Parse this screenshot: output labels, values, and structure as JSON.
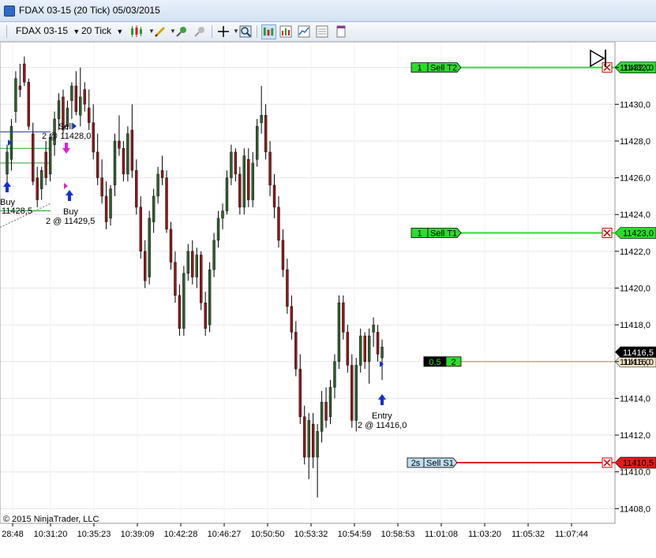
{
  "window": {
    "title": "FDAX 03-15 (20 Tick)  05/03/2015"
  },
  "toolbar": {
    "instrument": "FDAX 03-15",
    "interval": "20 Tick",
    "icons": [
      "candlestick-icon",
      "pencil-icon",
      "crosshair-icon",
      "magnifier-icon",
      "chart-trader-icon",
      "chart-type-icon",
      "properties-icon",
      "data-box-icon"
    ]
  },
  "price_axis": {
    "ticks": [
      "11432,0",
      "11430,0",
      "11428,0",
      "11426,0",
      "11424,0",
      "11422,0",
      "11420,0",
      "11418,0",
      "11416,0",
      "11414,0",
      "11412,0",
      "11410,0",
      "11408,0"
    ],
    "current_price": "11416,5",
    "last_price": "11416,0"
  },
  "time_axis": {
    "ticks": [
      "28:48",
      "10:31:20",
      "10:35:23",
      "10:39:09",
      "10:42:28",
      "10:46:27",
      "10:50:50",
      "10:53:32",
      "10:54:59",
      "10:58:53",
      "11:01:08",
      "11:03:20",
      "11:05:32",
      "11:07:44"
    ]
  },
  "orders": [
    {
      "qty": "1",
      "label": "Sell T2",
      "price": "11432,0",
      "kind": "target"
    },
    {
      "qty": "1",
      "label": "Sell T1",
      "price": "11423,0",
      "kind": "target"
    },
    {
      "qty": "2s",
      "label": "Sell S1",
      "price": "11410,5",
      "kind": "stop"
    }
  ],
  "position": {
    "pnl": "0,5",
    "qty": "2"
  },
  "executions": [
    {
      "title": "Buy",
      "detail": "11428,5"
    },
    {
      "title": "Sell",
      "detail": "2 @ 11428,0"
    },
    {
      "title": "Buy",
      "detail": "2 @ 11429,5"
    },
    {
      "title": "Entry",
      "detail": "2 @ 11416,0"
    }
  ],
  "copyright": "© 2015 NinjaTrader, LLC",
  "colors": {
    "up": "#2e5e2e",
    "down": "#8b1a1a",
    "target": "#2bdc2b",
    "stop": "#e01b1b",
    "position": "#c8a888"
  },
  "chart_data": {
    "type": "candlestick",
    "ylim": [
      11407.2,
      11433.4
    ],
    "candles": [
      {
        "o": 11426.2,
        "h": 11427.8,
        "l": 11425.4,
        "c": 11427.4
      },
      {
        "o": 11427.0,
        "h": 11429.2,
        "l": 11426.4,
        "c": 11428.8
      },
      {
        "o": 11429.6,
        "h": 11431.8,
        "l": 11429.0,
        "c": 11431.4
      },
      {
        "o": 11431.0,
        "h": 11432.2,
        "l": 11430.4,
        "c": 11430.8
      },
      {
        "o": 11432.2,
        "h": 11432.6,
        "l": 11431.0,
        "c": 11431.2
      },
      {
        "o": 11431.2,
        "h": 11431.4,
        "l": 11428.6,
        "c": 11428.8
      },
      {
        "o": 11428.4,
        "h": 11429.0,
        "l": 11425.6,
        "c": 11425.8
      },
      {
        "o": 11426.0,
        "h": 11426.6,
        "l": 11424.4,
        "c": 11424.8
      },
      {
        "o": 11425.4,
        "h": 11426.6,
        "l": 11424.8,
        "c": 11426.4
      },
      {
        "o": 11427.4,
        "h": 11428.0,
        "l": 11425.6,
        "c": 11426.0
      },
      {
        "o": 11426.2,
        "h": 11428.4,
        "l": 11425.8,
        "c": 11428.2
      },
      {
        "o": 11427.8,
        "h": 11429.6,
        "l": 11427.2,
        "c": 11429.2
      },
      {
        "o": 11429.2,
        "h": 11430.6,
        "l": 11428.6,
        "c": 11430.2
      },
      {
        "o": 11430.4,
        "h": 11430.8,
        "l": 11428.4,
        "c": 11428.6
      },
      {
        "o": 11428.8,
        "h": 11430.2,
        "l": 11428.6,
        "c": 11429.8
      },
      {
        "o": 11430.2,
        "h": 11431.2,
        "l": 11429.2,
        "c": 11431.0
      },
      {
        "o": 11431.0,
        "h": 11431.8,
        "l": 11429.4,
        "c": 11429.6
      },
      {
        "o": 11429.4,
        "h": 11432.0,
        "l": 11428.8,
        "c": 11430.4
      },
      {
        "o": 11430.8,
        "h": 11431.2,
        "l": 11429.6,
        "c": 11430.0
      },
      {
        "o": 11429.8,
        "h": 11430.8,
        "l": 11428.6,
        "c": 11429.0
      },
      {
        "o": 11429.0,
        "h": 11430.0,
        "l": 11427.0,
        "c": 11427.4
      },
      {
        "o": 11427.4,
        "h": 11428.4,
        "l": 11425.6,
        "c": 11426.0
      },
      {
        "o": 11426.0,
        "h": 11427.0,
        "l": 11424.6,
        "c": 11425.0
      },
      {
        "o": 11425.0,
        "h": 11425.8,
        "l": 11423.2,
        "c": 11423.6
      },
      {
        "o": 11423.8,
        "h": 11425.6,
        "l": 11423.4,
        "c": 11425.4
      },
      {
        "o": 11425.6,
        "h": 11428.4,
        "l": 11425.0,
        "c": 11428.0
      },
      {
        "o": 11428.0,
        "h": 11429.4,
        "l": 11427.2,
        "c": 11427.6
      },
      {
        "o": 11427.6,
        "h": 11428.0,
        "l": 11425.8,
        "c": 11426.2
      },
      {
        "o": 11426.2,
        "h": 11428.8,
        "l": 11425.8,
        "c": 11428.4
      },
      {
        "o": 11428.6,
        "h": 11430.0,
        "l": 11426.0,
        "c": 11426.4
      },
      {
        "o": 11426.4,
        "h": 11427.0,
        "l": 11424.0,
        "c": 11424.4
      },
      {
        "o": 11424.4,
        "h": 11425.0,
        "l": 11421.6,
        "c": 11422.0
      },
      {
        "o": 11422.0,
        "h": 11422.6,
        "l": 11420.0,
        "c": 11420.4
      },
      {
        "o": 11420.6,
        "h": 11424.2,
        "l": 11420.2,
        "c": 11423.8
      },
      {
        "o": 11423.6,
        "h": 11425.4,
        "l": 11423.0,
        "c": 11425.0
      },
      {
        "o": 11425.0,
        "h": 11426.6,
        "l": 11424.6,
        "c": 11426.2
      },
      {
        "o": 11426.4,
        "h": 11427.2,
        "l": 11425.6,
        "c": 11426.0
      },
      {
        "o": 11426.0,
        "h": 11426.4,
        "l": 11423.0,
        "c": 11423.2
      },
      {
        "o": 11423.2,
        "h": 11423.6,
        "l": 11421.0,
        "c": 11421.4
      },
      {
        "o": 11421.4,
        "h": 11422.0,
        "l": 11419.2,
        "c": 11419.6
      },
      {
        "o": 11419.6,
        "h": 11420.2,
        "l": 11417.4,
        "c": 11417.8
      },
      {
        "o": 11417.8,
        "h": 11421.2,
        "l": 11417.4,
        "c": 11420.8
      },
      {
        "o": 11420.8,
        "h": 11422.4,
        "l": 11420.4,
        "c": 11422.0
      },
      {
        "o": 11422.0,
        "h": 11422.6,
        "l": 11420.2,
        "c": 11420.6
      },
      {
        "o": 11420.6,
        "h": 11422.2,
        "l": 11420.0,
        "c": 11421.8
      },
      {
        "o": 11421.8,
        "h": 11422.0,
        "l": 11418.8,
        "c": 11419.2
      },
      {
        "o": 11419.2,
        "h": 11419.8,
        "l": 11417.4,
        "c": 11417.8
      },
      {
        "o": 11418.0,
        "h": 11421.4,
        "l": 11417.6,
        "c": 11421.0
      },
      {
        "o": 11421.0,
        "h": 11423.0,
        "l": 11420.6,
        "c": 11422.6
      },
      {
        "o": 11422.6,
        "h": 11424.2,
        "l": 11422.2,
        "c": 11423.8
      },
      {
        "o": 11423.8,
        "h": 11424.6,
        "l": 11423.2,
        "c": 11424.2
      },
      {
        "o": 11424.2,
        "h": 11426.4,
        "l": 11424.0,
        "c": 11426.0
      },
      {
        "o": 11426.0,
        "h": 11427.8,
        "l": 11425.6,
        "c": 11427.4
      },
      {
        "o": 11427.4,
        "h": 11427.6,
        "l": 11425.8,
        "c": 11426.2
      },
      {
        "o": 11426.2,
        "h": 11426.6,
        "l": 11424.0,
        "c": 11424.4
      },
      {
        "o": 11424.4,
        "h": 11427.6,
        "l": 11424.0,
        "c": 11427.2
      },
      {
        "o": 11427.0,
        "h": 11427.6,
        "l": 11424.4,
        "c": 11424.8
      },
      {
        "o": 11424.8,
        "h": 11427.4,
        "l": 11424.4,
        "c": 11426.8
      },
      {
        "o": 11427.0,
        "h": 11429.2,
        "l": 11426.6,
        "c": 11428.8
      },
      {
        "o": 11429.0,
        "h": 11431.0,
        "l": 11428.4,
        "c": 11429.4
      },
      {
        "o": 11429.4,
        "h": 11430.0,
        "l": 11427.0,
        "c": 11427.4
      },
      {
        "o": 11427.4,
        "h": 11428.0,
        "l": 11425.0,
        "c": 11425.6
      },
      {
        "o": 11425.6,
        "h": 11426.2,
        "l": 11423.8,
        "c": 11424.4
      },
      {
        "o": 11424.4,
        "h": 11425.0,
        "l": 11422.2,
        "c": 11422.6
      },
      {
        "o": 11422.6,
        "h": 11423.2,
        "l": 11420.6,
        "c": 11421.0
      },
      {
        "o": 11421.0,
        "h": 11421.6,
        "l": 11418.6,
        "c": 11419.0
      },
      {
        "o": 11419.0,
        "h": 11419.6,
        "l": 11417.2,
        "c": 11417.6
      },
      {
        "o": 11417.6,
        "h": 11418.2,
        "l": 11415.2,
        "c": 11415.6
      },
      {
        "o": 11415.6,
        "h": 11416.4,
        "l": 11412.6,
        "c": 11413.0
      },
      {
        "o": 11413.0,
        "h": 11413.6,
        "l": 11410.4,
        "c": 11410.8
      },
      {
        "o": 11410.8,
        "h": 11413.2,
        "l": 11409.6,
        "c": 11412.8
      },
      {
        "o": 11412.6,
        "h": 11413.2,
        "l": 11410.2,
        "c": 11410.8
      },
      {
        "o": 11410.8,
        "h": 11412.6,
        "l": 11408.6,
        "c": 11412.2
      },
      {
        "o": 11412.2,
        "h": 11414.4,
        "l": 11411.6,
        "c": 11413.8
      },
      {
        "o": 11413.8,
        "h": 11414.6,
        "l": 11412.4,
        "c": 11412.8
      },
      {
        "o": 11413.0,
        "h": 11415.0,
        "l": 11412.6,
        "c": 11414.6
      },
      {
        "o": 11414.6,
        "h": 11416.4,
        "l": 11414.0,
        "c": 11416.0
      },
      {
        "o": 11416.0,
        "h": 11419.6,
        "l": 11415.6,
        "c": 11419.2
      },
      {
        "o": 11419.2,
        "h": 11419.6,
        "l": 11417.2,
        "c": 11417.6
      },
      {
        "o": 11417.6,
        "h": 11418.0,
        "l": 11415.4,
        "c": 11415.8
      },
      {
        "o": 11415.8,
        "h": 11416.4,
        "l": 11412.4,
        "c": 11412.8
      },
      {
        "o": 11412.8,
        "h": 11416.2,
        "l": 11412.2,
        "c": 11415.8
      },
      {
        "o": 11415.8,
        "h": 11417.8,
        "l": 11415.4,
        "c": 11417.4
      },
      {
        "o": 11417.4,
        "h": 11417.6,
        "l": 11415.6,
        "c": 11416.0
      },
      {
        "o": 11416.0,
        "h": 11417.8,
        "l": 11414.8,
        "c": 11417.4
      },
      {
        "o": 11417.6,
        "h": 11418.4,
        "l": 11416.8,
        "c": 11418.0
      },
      {
        "o": 11417.6,
        "h": 11418.0,
        "l": 11416.0,
        "c": 11416.4
      },
      {
        "o": 11416.2,
        "h": 11417.2,
        "l": 11415.0,
        "c": 11416.8
      }
    ]
  }
}
